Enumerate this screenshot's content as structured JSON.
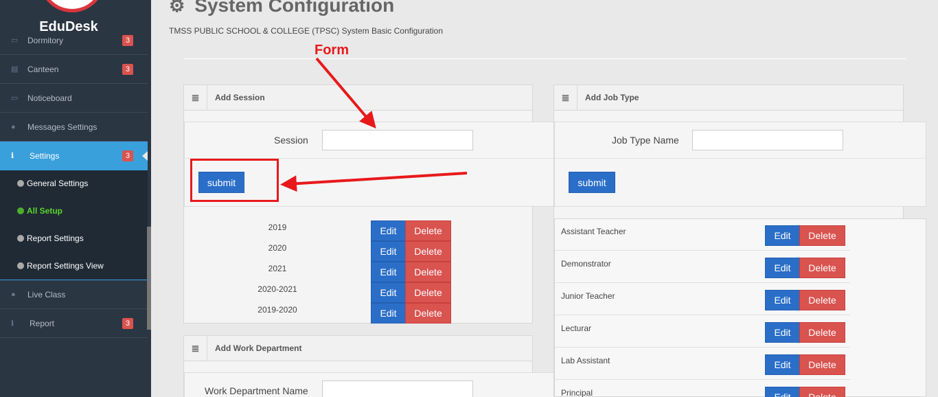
{
  "brand": {
    "name": "EduDesk"
  },
  "sidebar": {
    "items": [
      {
        "label": "Dormitory",
        "badge": "3",
        "icon": "bed-icon"
      },
      {
        "label": "Canteen",
        "badge": "3",
        "icon": "card-icon"
      },
      {
        "label": "Noticeboard",
        "badge": "",
        "icon": "window-icon"
      },
      {
        "label": "Messages Settings",
        "badge": "",
        "icon": "chat-icon"
      },
      {
        "label": "Settings",
        "badge": "3",
        "icon": "info-icon",
        "active": true
      },
      {
        "label": "Live Class",
        "badge": "",
        "icon": "chat-icon"
      },
      {
        "label": "Report",
        "badge": "3",
        "icon": "info-icon"
      }
    ],
    "submenu": [
      {
        "label": "General Settings"
      },
      {
        "label": "All Setup",
        "current": true
      },
      {
        "label": "Report Settings"
      },
      {
        "label": "Report Settings View"
      }
    ]
  },
  "page": {
    "title": "System Configuration",
    "subtitle": "TMSS PUBLIC SCHOOL & COLLEGE (TPSC) System Basic Configuration"
  },
  "add_session": {
    "title": "Add Session",
    "field_label": "Session",
    "field_value": "",
    "submit_label": "submit",
    "sessions": [
      "2019",
      "2020",
      "2021",
      "2020-2021",
      "2019-2020"
    ]
  },
  "add_job_type": {
    "title": "Add Job Type",
    "field_label": "Job Type Name",
    "field_value": "",
    "submit_label": "submit",
    "job_types": [
      "Assistant Teacher",
      "Demonstrator",
      "Junior Teacher",
      "Lecturar",
      "Lab Assistant",
      "Principal"
    ]
  },
  "add_work_department": {
    "title": "Add Work Department",
    "field_label": "Work Department Name",
    "field_value": ""
  },
  "actions": {
    "edit": "Edit",
    "delete": "Delete"
  },
  "annotation": {
    "form_label": "Form"
  },
  "colors": {
    "accent": "#3aa0dc",
    "primary_button": "#2a6ec8",
    "danger_button": "#d9534f",
    "annotation": "#e8191b"
  }
}
